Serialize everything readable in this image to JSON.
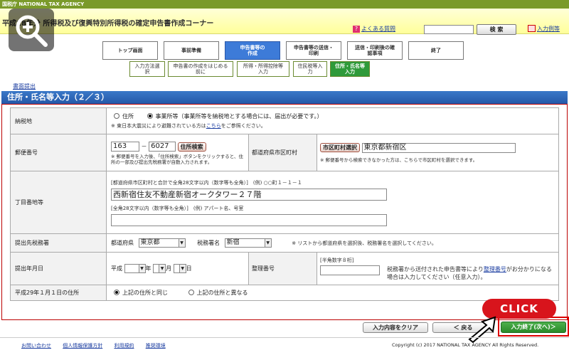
{
  "agency": "国税庁  NATIONAL TAX AGENCY",
  "title": "平成28年分 所得税及び復興特別所得税の確定申告書作成コーナー",
  "faq_label": "よくある質問",
  "faq_icon": "?",
  "search_button": "検 索",
  "example_label": "入力例等",
  "steps": [
    "トップ画面",
    "事前準備",
    "申告書等の作成",
    "申告書等の送信・印刷",
    "送信・印刷後の確認事項",
    "終了"
  ],
  "substeps": [
    "入力方法選択",
    "申告書の作成をはじめる前に",
    "所得・所得控除等入力",
    "住民税等入力",
    "住所・氏名等入力"
  ],
  "submit_link": "書面提出",
  "page_title": "住所・氏名等入力（２／３）",
  "rows": {
    "tax_place": {
      "label": "納税地",
      "opt1": "住所",
      "opt2": "事業所等（事業所等を納税地とする場合には、届出が必要です。）",
      "note_pre": "※ 東日本大震災により避難されている方は",
      "note_link": "こちら",
      "note_post": "をご参照ください。"
    },
    "postal": {
      "label": "郵便番号",
      "zip1": "163",
      "dash": "－",
      "zip2": "6027",
      "search_btn": "住所検索",
      "note": "※ 郵便番号を入力後、「住所検索」ボタンをクリックすると、住所の一部及び提出先税務署が自動入力されます。",
      "pref_label": "都道府県市区町村",
      "city_btn": "市区町村選択",
      "city_value": "東京都新宿区",
      "city_note": "※ 郵便番号から検索できなかった方は、こちらで市区町村を選択できます。"
    },
    "address": {
      "label": "丁目番地等",
      "hint1": "[都道府県市区町村と合計で全角28文字以内（数字等も全角）]　(例) ○○町１－１－１",
      "value1": "西新宿住友不動産新宿オークタワー２７階",
      "hint2": "[全角28文字以内（数字等も全角）]　(例) アパート名、号室",
      "value2": ""
    },
    "office": {
      "label": "提出先税務署",
      "pref_label": "都道府県",
      "pref_value": "東京都",
      "office_label": "税務署名",
      "office_value": "新宿",
      "note": "※ リストから都道府県を選択後、税務署名を選択してください。"
    },
    "date": {
      "label": "提出年月日",
      "era": "平成",
      "y_unit": "年",
      "m_unit": "月",
      "d_unit": "日",
      "ref_label": "整理番号",
      "ref_hint": "[半角数字８桁]",
      "ref_note_pre": "税務署から送付された申告書等により",
      "ref_note_link": "整理番号",
      "ref_note_post": "がお分かりになる場合は入力してください（任意入力）。"
    },
    "jan_address": {
      "label": "平成29年１月１日の住所",
      "opt1": "上記の住所と同じ",
      "opt2": "上記の住所と異なる"
    }
  },
  "buttons": {
    "clear": "入力内容をクリア",
    "back": "＜ 戻る",
    "next": "入力終了(次へ)＞"
  },
  "click_label": "CLICK",
  "footer": {
    "links": [
      "お問い合わせ",
      "個人情報保護方針",
      "利用規約",
      "推奨環境"
    ],
    "copyright": "Copyright (c) 2017 NATIONAL TAX AGENCY All Rights Reserved."
  }
}
